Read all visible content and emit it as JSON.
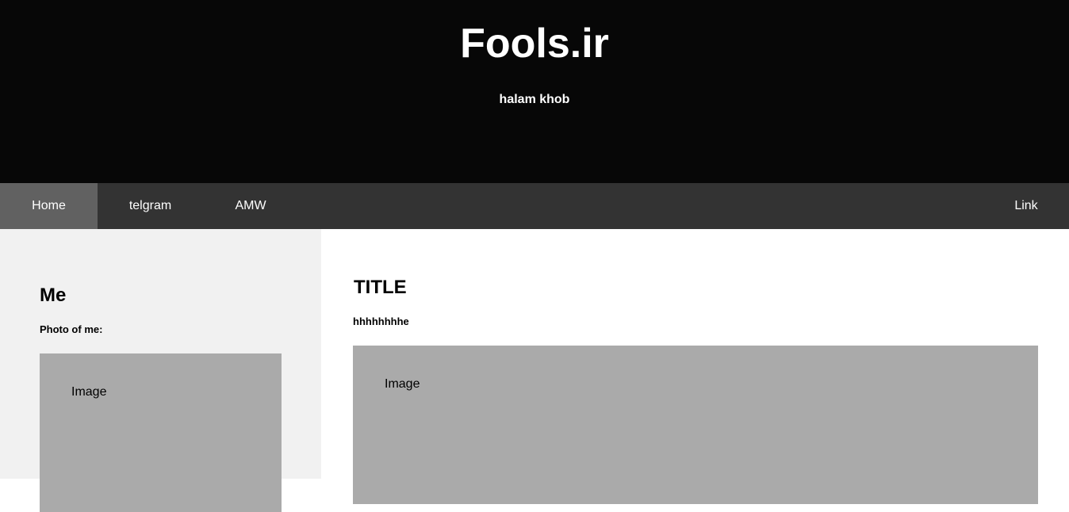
{
  "header": {
    "title": "Fools.ir",
    "tagline": "halam khob"
  },
  "nav": {
    "items": [
      {
        "label": "Home",
        "active": true
      },
      {
        "label": "telgram",
        "active": false
      },
      {
        "label": "AMW",
        "active": false
      }
    ],
    "right_link": "Link"
  },
  "sidebar": {
    "heading": "Me",
    "subheading": "Photo of me:",
    "image_label": "Image"
  },
  "main": {
    "heading": "TITLE",
    "subheading": "hhhhhhhhe",
    "image_label": "Image"
  },
  "colors": {
    "header_bg": "#070707",
    "nav_bg": "#333333",
    "nav_active_bg": "#616161",
    "sidebar_bg": "#f1f1f1",
    "image_placeholder_bg": "#aaaaaa"
  }
}
